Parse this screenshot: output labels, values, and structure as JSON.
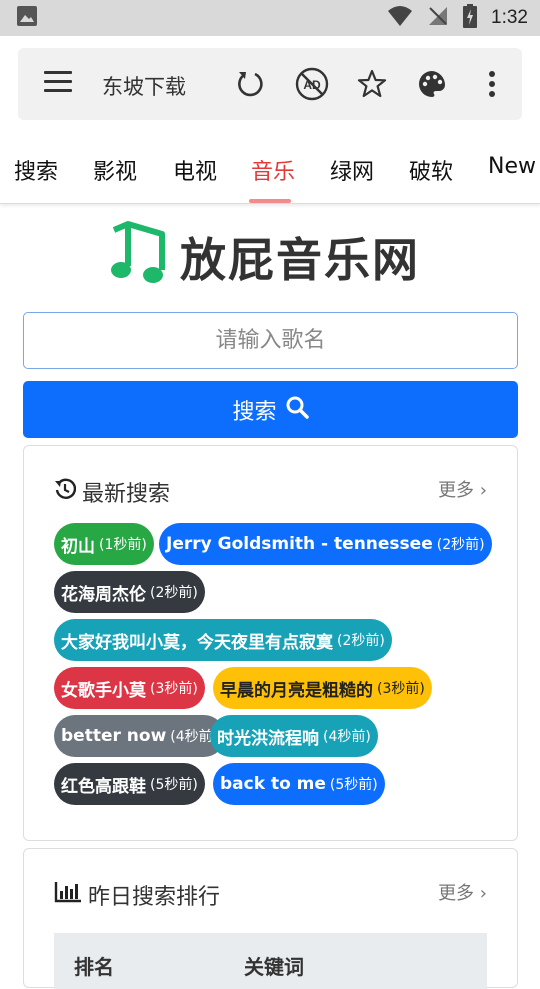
{
  "status_bar": {
    "time": "1:32"
  },
  "app_bar": {
    "title": "东坡下载"
  },
  "tabs": [
    "搜索",
    "影视",
    "电视",
    "音乐",
    "绿网",
    "破软",
    "New"
  ],
  "active_tab": "音乐",
  "site": {
    "name": "放屁音乐网"
  },
  "search": {
    "placeholder": "请输入歌名",
    "button_label": "搜索"
  },
  "latest": {
    "title": "最新搜索",
    "more": "更多",
    "tags": [
      {
        "name": "初山",
        "ago": "(1秒前)",
        "color": "#28a745"
      },
      {
        "name": "Jerry Goldsmith - tennessee",
        "ago": "(2秒前)",
        "color": "#0d6efd"
      },
      {
        "name": "花海周杰伦",
        "ago": "(2秒前)",
        "color": "#343a40"
      },
      {
        "name": "大家好我叫小莫，今天夜里有点寂寞",
        "ago": "(2秒前)",
        "color": "#17a2b8"
      },
      {
        "name": "女歌手小莫",
        "ago": "(3秒前)",
        "color": "#dc3545"
      },
      {
        "name": "早晨的月亮是粗糙的",
        "ago": "(3秒前)",
        "color": "#ffc107"
      },
      {
        "name": "better now",
        "ago": "(4秒前)",
        "color": "#6c757d"
      },
      {
        "name": "时光洪流程响",
        "ago": "(4秒前)",
        "color": "#17a2b8"
      },
      {
        "name": "红色高跟鞋",
        "ago": "(5秒前)",
        "color": "#343a40"
      },
      {
        "name": "back to me",
        "ago": "(5秒前)",
        "color": "#0d6efd"
      }
    ]
  },
  "ranking": {
    "title": "昨日搜索排行",
    "more": "更多",
    "columns": [
      "排名",
      "关键词"
    ]
  }
}
